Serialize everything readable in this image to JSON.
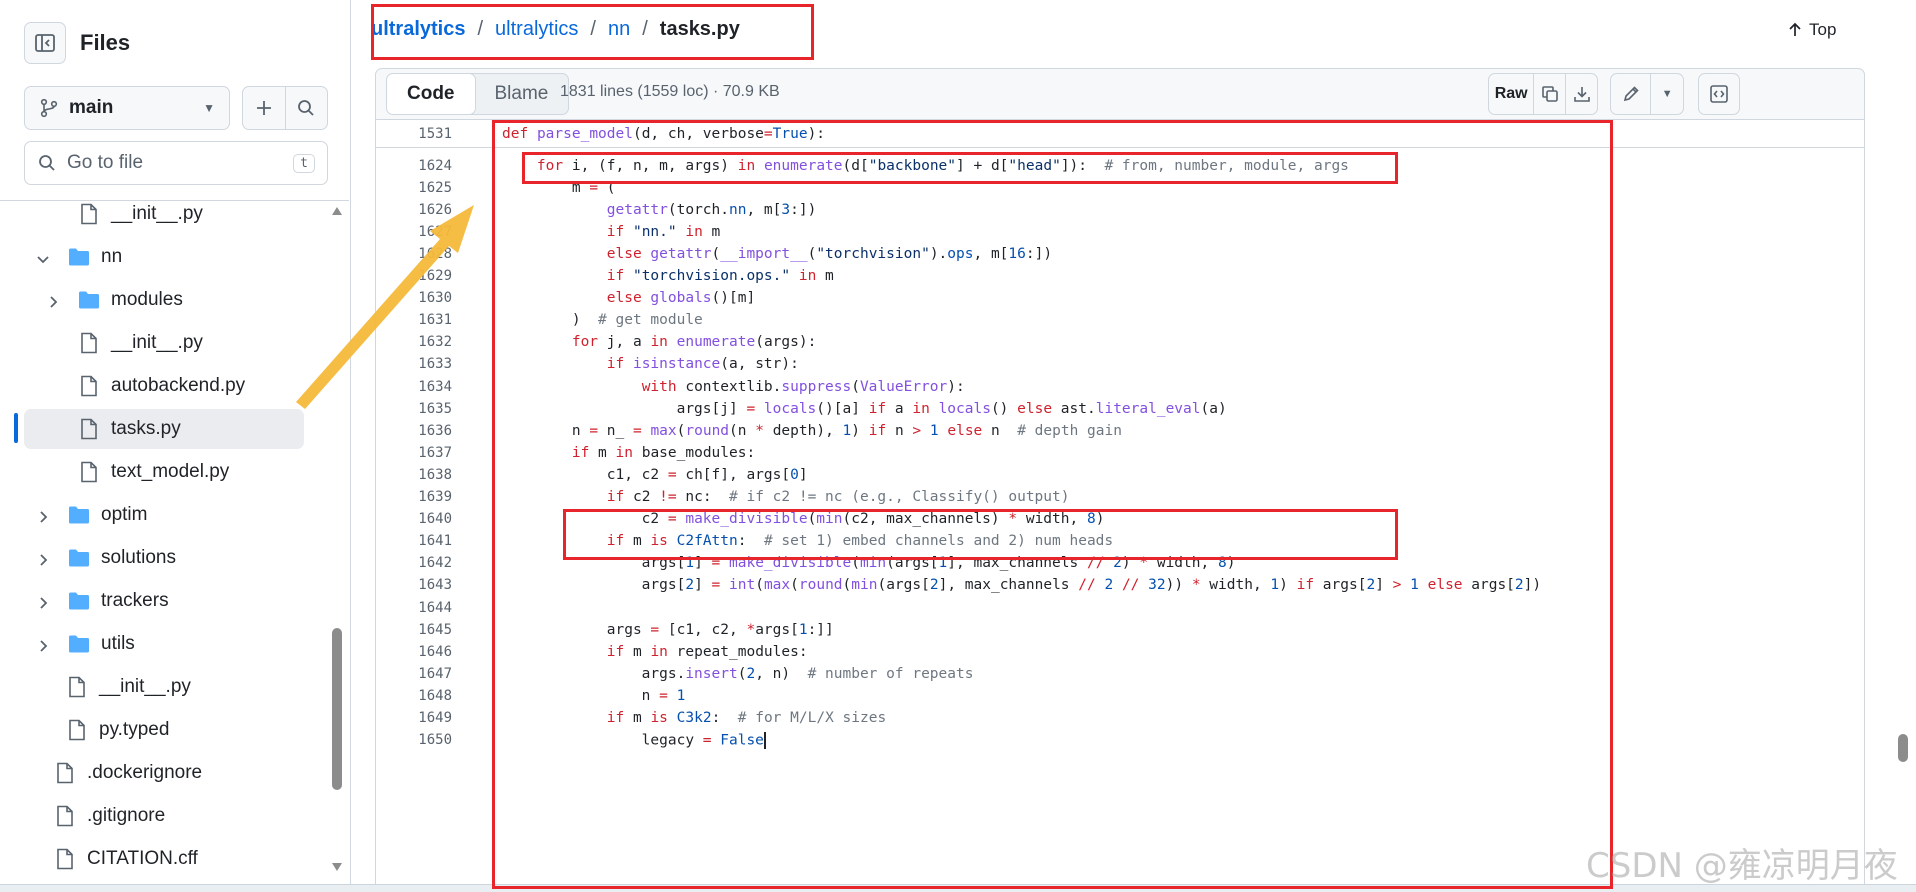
{
  "sidebar": {
    "title": "Files",
    "branch": "main",
    "goto_placeholder": "Go to file",
    "goto_shortcut": "t",
    "items": [
      {
        "label": "__init__.py",
        "kind": "file",
        "level": 3
      },
      {
        "label": "nn",
        "kind": "folder",
        "level": 2,
        "expanded": true
      },
      {
        "label": "modules",
        "kind": "folder",
        "level": 3,
        "expanded": false
      },
      {
        "label": "__init__.py",
        "kind": "file",
        "level": 3
      },
      {
        "label": "autobackend.py",
        "kind": "file",
        "level": 3
      },
      {
        "label": "tasks.py",
        "kind": "file",
        "level": 3,
        "selected": true
      },
      {
        "label": "text_model.py",
        "kind": "file",
        "level": 3
      },
      {
        "label": "optim",
        "kind": "folder",
        "level": 2,
        "expanded": false
      },
      {
        "label": "solutions",
        "kind": "folder",
        "level": 2,
        "expanded": false
      },
      {
        "label": "trackers",
        "kind": "folder",
        "level": 2,
        "expanded": false
      },
      {
        "label": "utils",
        "kind": "folder",
        "level": 2,
        "expanded": false
      },
      {
        "label": "__init__.py",
        "kind": "file",
        "level": 2
      },
      {
        "label": "py.typed",
        "kind": "file",
        "level": 2
      },
      {
        "label": ".dockerignore",
        "kind": "file",
        "level": 1
      },
      {
        "label": ".gitignore",
        "kind": "file",
        "level": 1
      },
      {
        "label": "CITATION.cff",
        "kind": "file",
        "level": 1
      }
    ]
  },
  "breadcrumb": {
    "repo": "ultralytics",
    "folder": "ultralytics",
    "subfolder": "nn",
    "file": "tasks.py",
    "sep": "/"
  },
  "top_label": "Top",
  "file_header": {
    "tab_code": "Code",
    "tab_blame": "Blame",
    "meta": "1831 lines (1559 loc) · 70.9 KB",
    "raw_label": "Raw"
  },
  "code": [
    {
      "num": "1531",
      "text": "def parse_model(d, ch, verbose=True):"
    },
    {
      "num": "1624",
      "text": "    for i, (f, n, m, args) in enumerate(d[\"backbone\"] + d[\"head\"]):  # from, number, module, args"
    },
    {
      "num": "1625",
      "text": "        m = ("
    },
    {
      "num": "1626",
      "text": "            getattr(torch.nn, m[3:])"
    },
    {
      "num": "1627",
      "text": "            if \"nn.\" in m"
    },
    {
      "num": "1628",
      "text": "            else getattr(__import__(\"torchvision\").ops, m[16:])"
    },
    {
      "num": "1629",
      "text": "            if \"torchvision.ops.\" in m"
    },
    {
      "num": "1630",
      "text": "            else globals()[m]"
    },
    {
      "num": "1631",
      "text": "        )  # get module"
    },
    {
      "num": "1632",
      "text": "        for j, a in enumerate(args):"
    },
    {
      "num": "1633",
      "text": "            if isinstance(a, str):"
    },
    {
      "num": "1634",
      "text": "                with contextlib.suppress(ValueError):"
    },
    {
      "num": "1635",
      "text": "                    args[j] = locals()[a] if a in locals() else ast.literal_eval(a)"
    },
    {
      "num": "1636",
      "text": "        n = n_ = max(round(n * depth), 1) if n > 1 else n  # depth gain"
    },
    {
      "num": "1637",
      "text": "        if m in base_modules:"
    },
    {
      "num": "1638",
      "text": "            c1, c2 = ch[f], args[0]"
    },
    {
      "num": "1639",
      "text": "            if c2 != nc:  # if c2 != nc (e.g., Classify() output)"
    },
    {
      "num": "1640",
      "text": "                c2 = make_divisible(min(c2, max_channels) * width, 8)"
    },
    {
      "num": "1641",
      "text": "            if m is C2fAttn:  # set 1) embed channels and 2) num heads"
    },
    {
      "num": "1642",
      "text": "                args[1] = make_divisible(min(args[1], max_channels // 2) * width, 8)"
    },
    {
      "num": "1643",
      "text": "                args[2] = int(max(round(min(args[2], max_channels // 2 // 32)) * width, 1) if args[2] > 1 else args[2])"
    },
    {
      "num": "1644",
      "text": ""
    },
    {
      "num": "1645",
      "text": "            args = [c1, c2, *args[1:]]"
    },
    {
      "num": "1646",
      "text": "            if m in repeat_modules:"
    },
    {
      "num": "1647",
      "text": "                args.insert(2, n)  # number of repeats"
    },
    {
      "num": "1648",
      "text": "                n = 1"
    },
    {
      "num": "1649",
      "text": "            if m is C3k2:  # for M/L/X sizes"
    },
    {
      "num": "1650",
      "text": "                legacy = False"
    }
  ],
  "watermark": "CSDN @雍凉明月夜",
  "colors": {
    "accent": "#0969da",
    "annotation_red": "#e8252a",
    "arrow_yellow": "#f6b93b"
  }
}
